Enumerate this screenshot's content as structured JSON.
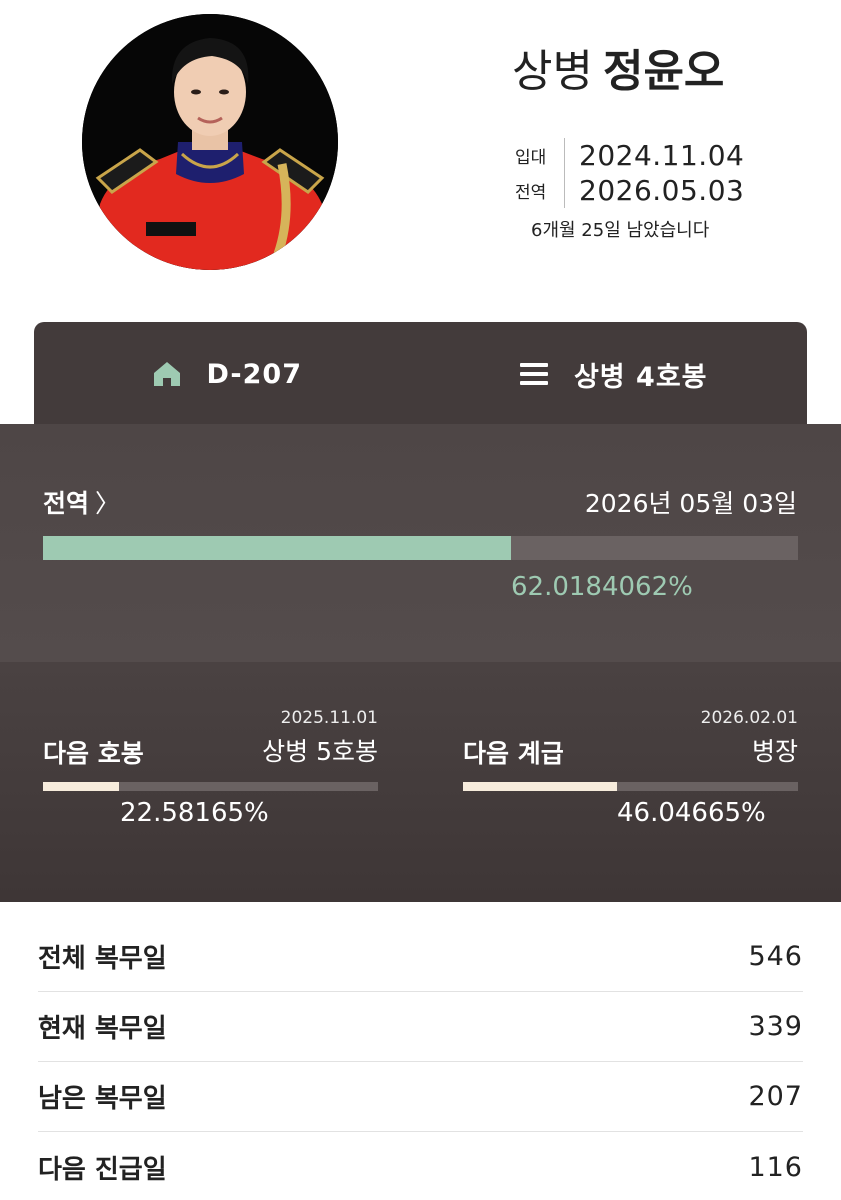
{
  "profile": {
    "rank": "상병",
    "name": "정윤오",
    "enlist_label": "입대",
    "enlist_date": "2024.11.04",
    "discharge_label": "전역",
    "discharge_date": "2026.05.03",
    "remaining_text": "6개월 25일 남았습니다"
  },
  "tabs": {
    "home_label": "D-207",
    "grade_label": "상병 4호봉"
  },
  "discharge": {
    "title": "전역",
    "chevron": "〉",
    "date_text": "2026년 05월 03일",
    "progress": 0.620184062,
    "percent_text": "62.0184062%"
  },
  "next_step": {
    "title": "다음 호봉",
    "date": "2025.11.01",
    "target": "상병 5호봉",
    "progress": 0.2258165,
    "percent_text": "22.58165%"
  },
  "next_rank": {
    "title": "다음 계급",
    "date": "2026.02.01",
    "target": "병장",
    "progress": 0.4604665,
    "percent_text": "46.04665%"
  },
  "stats": [
    {
      "label": "전체 복무일",
      "value": "546"
    },
    {
      "label": "현재 복무일",
      "value": "339"
    },
    {
      "label": "남은 복무일",
      "value": "207"
    },
    {
      "label": "다음 진급일",
      "value": "116"
    }
  ],
  "colors": {
    "accent_green": "#9ecab2",
    "accent_cream": "#f7ecdc",
    "panel_dark": "#433b3b",
    "uniform_red": "#e2291f"
  },
  "icons": {
    "home": "home-icon",
    "grade": "menu-icon"
  }
}
